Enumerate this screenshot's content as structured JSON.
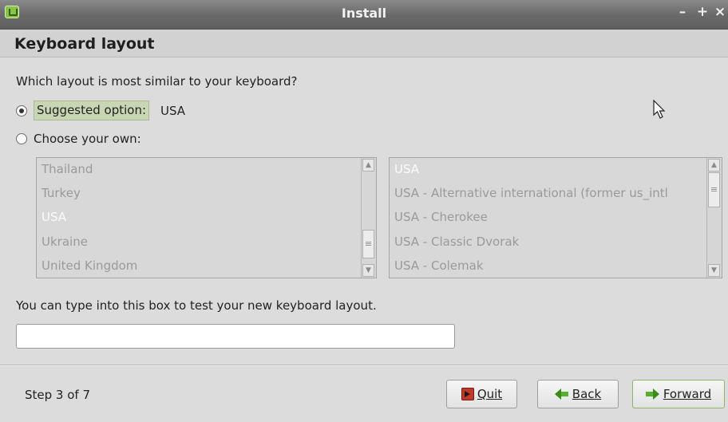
{
  "window": {
    "title": "Install",
    "controls": {
      "minimize": "–",
      "maximize": "+",
      "close": "×"
    }
  },
  "page": {
    "heading": "Keyboard layout",
    "question": "Which layout is most similar to your keyboard?",
    "suggested": {
      "label": "Suggested option:",
      "value": "USA",
      "checked": true
    },
    "choose_own": {
      "label": "Choose your own:",
      "checked": false
    }
  },
  "layouts": {
    "items": [
      "Thailand",
      "Turkey",
      "USA",
      "Ukraine",
      "United Kingdom"
    ],
    "selected": "USA"
  },
  "variants": {
    "items": [
      "USA",
      "USA - Alternative international (former us_intl",
      "USA - Cherokee",
      "USA - Classic Dvorak",
      "USA - Colemak"
    ],
    "selected": "USA"
  },
  "test": {
    "label": "You can type into this box to test your new keyboard layout.",
    "value": ""
  },
  "footer": {
    "step": "Step 3 of 7",
    "quit_label": "Quit",
    "back_label": "Back",
    "forward_label": "Forward"
  },
  "icons": {
    "window": "mint-logo-icon",
    "quit": "quit-icon",
    "back": "back-arrow-icon",
    "forward": "forward-arrow-icon"
  }
}
